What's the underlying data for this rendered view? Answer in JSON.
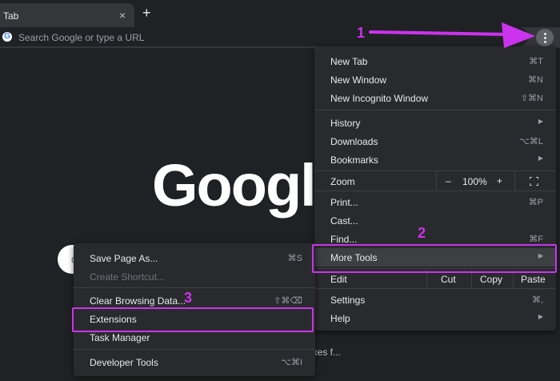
{
  "browser": {
    "tab_title": "Tab",
    "tab_close": "×",
    "new_tab_symbol": "+",
    "omnibox_placeholder": "Search Google or type a URL",
    "favicon_letter": "G"
  },
  "ntp": {
    "logo": "Google",
    "search_hint": "G",
    "tile_text": "ixes f..."
  },
  "main_menu": {
    "new_tab": {
      "label": "New Tab",
      "shortcut": "⌘T"
    },
    "new_window": {
      "label": "New Window",
      "shortcut": "⌘N"
    },
    "new_incognito": {
      "label": "New Incognito Window",
      "shortcut": "⇧⌘N"
    },
    "history": {
      "label": "History"
    },
    "downloads": {
      "label": "Downloads",
      "shortcut": "⌥⌘L"
    },
    "bookmarks": {
      "label": "Bookmarks"
    },
    "zoom": {
      "label": "Zoom",
      "minus": "–",
      "value": "100%",
      "plus": "+"
    },
    "print": {
      "label": "Print...",
      "shortcut": "⌘P"
    },
    "cast": {
      "label": "Cast..."
    },
    "find": {
      "label": "Find...",
      "shortcut": "⌘F"
    },
    "more_tools": {
      "label": "More Tools"
    },
    "edit": {
      "label": "Edit",
      "cut": "Cut",
      "copy": "Copy",
      "paste": "Paste"
    },
    "settings": {
      "label": "Settings",
      "shortcut": "⌘,"
    },
    "help": {
      "label": "Help"
    }
  },
  "sub_menu": {
    "save_page": {
      "label": "Save Page As...",
      "shortcut": "⌘S"
    },
    "create_shortcut": {
      "label": "Create Shortcut..."
    },
    "clear_browsing": {
      "label": "Clear Browsing Data...",
      "shortcut": "⇧⌘⌫"
    },
    "extensions": {
      "label": "Extensions"
    },
    "task_manager": {
      "label": "Task Manager"
    },
    "developer_tools": {
      "label": "Developer Tools",
      "shortcut": "⌥⌘I"
    }
  },
  "annotations": {
    "step1": "1",
    "step2": "2",
    "step3": "3",
    "color": "#cc33ee"
  },
  "submenu_arrow": "▶"
}
